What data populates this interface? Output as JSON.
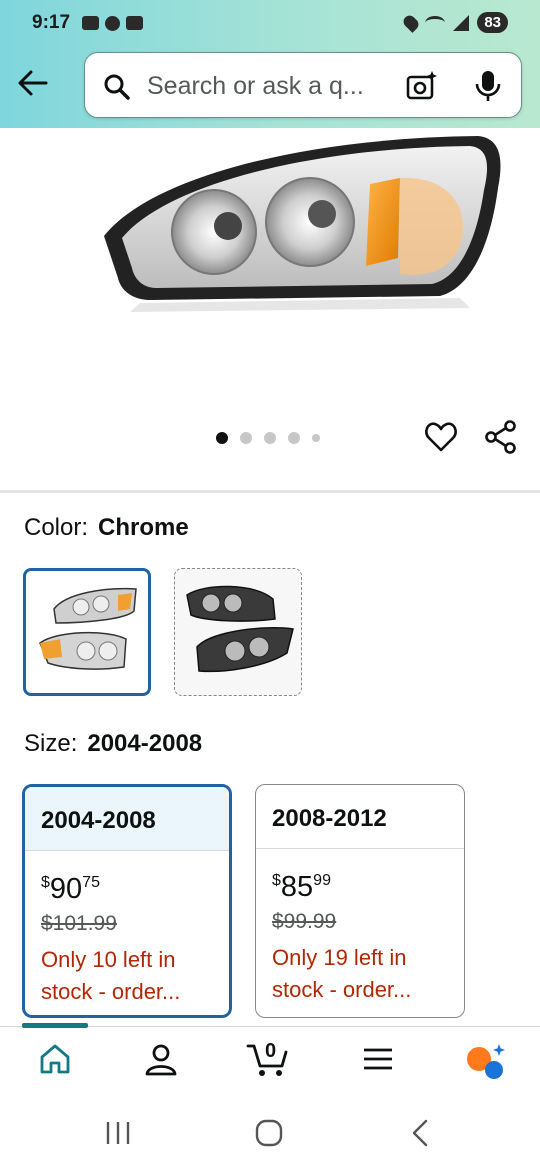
{
  "status_bar": {
    "time": "9:17",
    "battery": "83"
  },
  "search": {
    "placeholder": "Search or ask a q..."
  },
  "gallery": {
    "image_count": 5,
    "active_index": 0
  },
  "color": {
    "label": "Color:",
    "value": "Chrome"
  },
  "size": {
    "label": "Size:",
    "value": "2004-2008"
  },
  "size_options": [
    {
      "title": "2004-2008",
      "price_symbol": "$",
      "price_whole": "90",
      "price_cents": "75",
      "was_price": "$101.99",
      "stock": "Only 10 left in stock - order..."
    },
    {
      "title": "2008-2012",
      "price_symbol": "$",
      "price_whole": "85",
      "price_cents": "99",
      "was_price": "$99.99",
      "stock": "Only 19 left in stock - order..."
    }
  ],
  "bottom_nav": {
    "cart_count": "0"
  },
  "colors": {
    "accent_blue": "#2162a1",
    "teal": "#137a83",
    "deal_red": "#b12704"
  }
}
